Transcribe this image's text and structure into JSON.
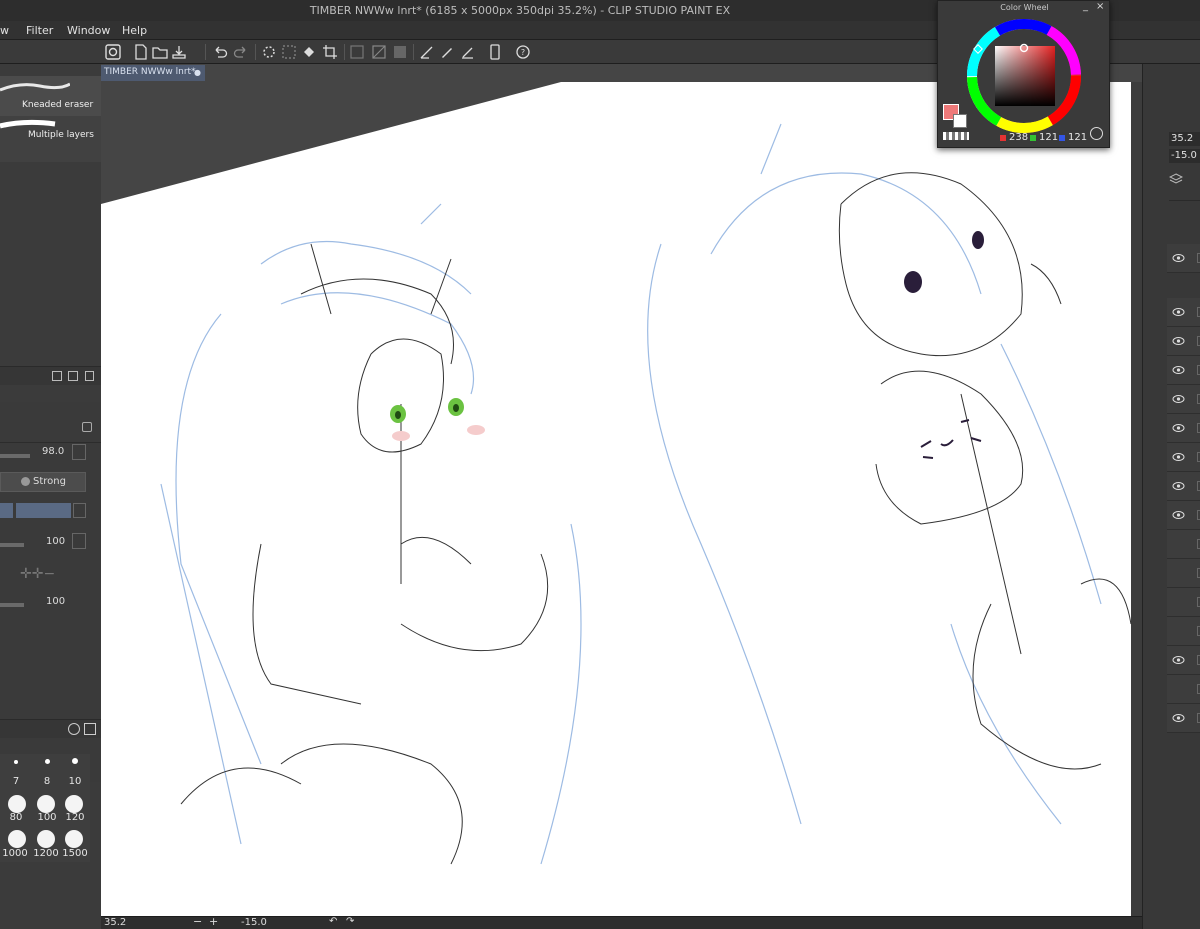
{
  "window": {
    "title": "TIMBER NWWw lnrt* (6185 x 5000px 350dpi 35.2%)  - CLIP STUDIO PAINT EX"
  },
  "menu": {
    "items": [
      "w",
      "Filter",
      "Window",
      "Help"
    ]
  },
  "document_tab": {
    "label": "TIMBER NWWw lnrt*"
  },
  "brush_subtools": [
    {
      "label": "Kneaded eraser"
    },
    {
      "label": "Multiple layers"
    }
  ],
  "tool_property": {
    "brush_density": "98.0",
    "hardness": "Strong",
    "opacity1": "100",
    "opacity2": "100"
  },
  "brush_sizes": {
    "row1": [
      "7",
      "8",
      "10"
    ],
    "row2": [
      "80",
      "100",
      "120"
    ],
    "row3": [
      "1000",
      "1200",
      "1500"
    ]
  },
  "navigator": {
    "zoom": "35.2",
    "rotation": "-15.0"
  },
  "status": {
    "zoom": "35.2",
    "rotation": "-15.0"
  },
  "color_wheel": {
    "title": "Color Wheel",
    "r": "238",
    "g": "121",
    "b": "121",
    "main_color": "#ee7979"
  }
}
